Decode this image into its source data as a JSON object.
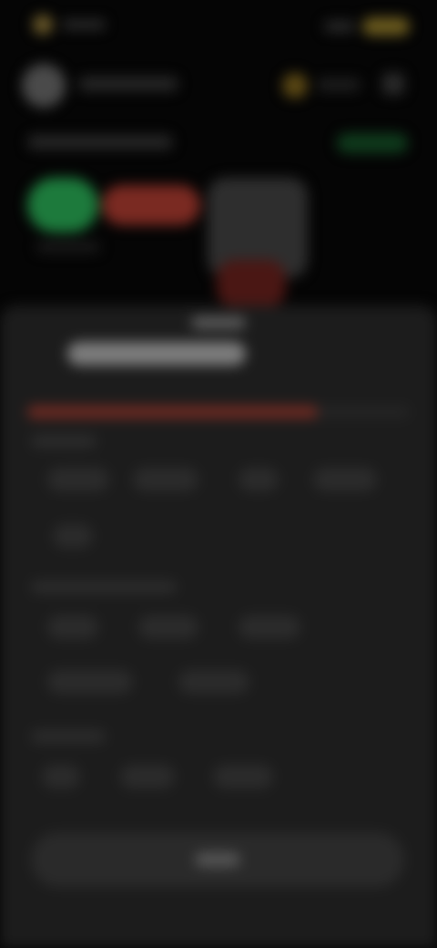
{
  "colors": {
    "background": "#050505",
    "sheet": "#1c1c1c",
    "accent_green": "#1d7a3c",
    "accent_red": "#7a2a22",
    "accent_gold": "#6a5a1e"
  },
  "status": {
    "left_icon": "app-icon",
    "right_icon": "battery-icon"
  },
  "header": {
    "avatar_icon": "user-avatar",
    "coin_icon": "coin-icon",
    "menu_icon": "menu-icon"
  },
  "progress": {
    "fill_percent": 76
  }
}
